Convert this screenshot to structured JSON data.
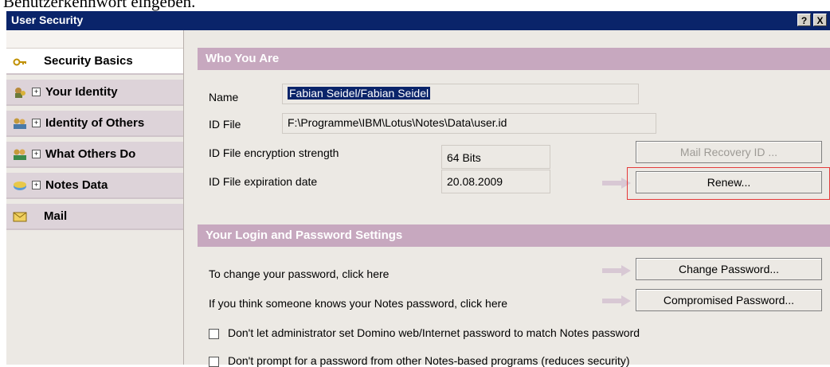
{
  "above_text": "Benutzerkennwort eingeben.",
  "window": {
    "title": "User Security",
    "help_btn": "?",
    "close_btn": "X"
  },
  "sidebar": {
    "items": [
      {
        "label": "Security Basics",
        "icon": "key-icon",
        "expandable": false,
        "active": true
      },
      {
        "label": "Your Identity",
        "icon": "identity-icon",
        "expandable": true,
        "active": false
      },
      {
        "label": "Identity of Others",
        "icon": "people-icon",
        "expandable": true,
        "active": false
      },
      {
        "label": "What Others Do",
        "icon": "others-do-icon",
        "expandable": true,
        "active": false
      },
      {
        "label": "Notes Data",
        "icon": "notes-data-icon",
        "expandable": true,
        "active": false
      },
      {
        "label": "Mail",
        "icon": "mail-icon",
        "expandable": false,
        "active": false
      }
    ],
    "plus_glyph": "+"
  },
  "who": {
    "header": "Who You Are",
    "name_label": "Name",
    "name_value": "Fabian Seidel/Fabian Seidel",
    "idfile_label": "ID File",
    "idfile_value": "F:\\Programme\\IBM\\Lotus\\Notes\\Data\\user.id",
    "enc_label": "ID File encryption strength",
    "enc_value": "64 Bits",
    "exp_label": "ID File expiration date",
    "exp_value": "20.08.2009",
    "mail_recovery_btn": "Mail Recovery ID ...",
    "renew_btn": "Renew..."
  },
  "login": {
    "header": "Your Login and Password Settings",
    "change_label": "To change your password, click here",
    "change_btn": "Change Password...",
    "compromised_label": "If you think someone knows your Notes password, click here",
    "compromised_btn": "Compromised Password...",
    "check1_label": "Don't let administrator set Domino web/Internet password to match Notes password",
    "check2_label": "Don't prompt for a password from other Notes-based programs (reduces security)"
  },
  "colors": {
    "titlebar": "#0a246a",
    "section_header": "#c7a8bf",
    "sidebar_item": "#ddd3d9",
    "highlight": "#e53a3a"
  }
}
